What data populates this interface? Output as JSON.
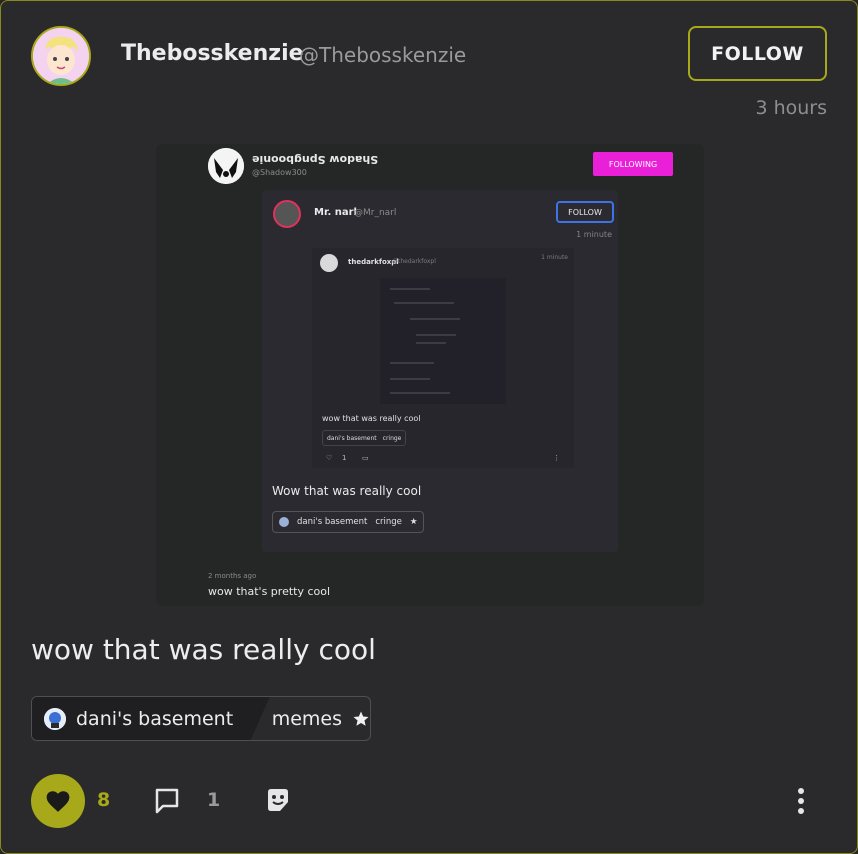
{
  "post": {
    "author_name": "Thebosskenzie",
    "author_handle": "@Thebosskenzie",
    "follow_label": "FOLLOW",
    "time": "3 hours",
    "text": "wow that was really cool"
  },
  "embed": {
    "level1": {
      "name": "Shadow Spngboonie",
      "handle": "@Shadow300",
      "following_label": "FOLLOWING",
      "time": "2 months ago",
      "text": "wow that's pretty cool"
    },
    "level2": {
      "name": "Mr. narl",
      "handle": "@Mr_narl",
      "follow_label": "FOLLOW",
      "time": "1 minute",
      "text": "Wow that was really cool",
      "tag_community": "dani's basement",
      "tag_category": "cringe"
    },
    "level3": {
      "name": "thedarkfoxpl",
      "handle": "@thedarkfoxpl",
      "time": "1 minute",
      "text": "wow that was really cool",
      "tag_community": "dani's basement",
      "tag_category": "cringe",
      "like_count": "1"
    }
  },
  "tag": {
    "community": "dani's basement",
    "category": "memes",
    "icon": "community-avatar-icon",
    "favorite_icon": "star-icon"
  },
  "actions": {
    "like_count": "8",
    "comment_count": "1",
    "like_icon": "heart-icon",
    "comment_icon": "comment-icon",
    "sticker_icon": "sticker-icon",
    "more_icon": "more-vertical-icon"
  },
  "colors": {
    "accent": "#a7a91b",
    "background": "#2a2a2c",
    "following": "#ea1fd8",
    "follow_blue": "#3c74e6"
  }
}
